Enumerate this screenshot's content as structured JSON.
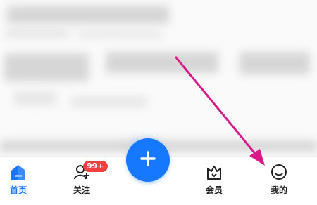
{
  "tabbar": {
    "tabs": [
      {
        "label": "首页",
        "icon": "home-icon",
        "active": true
      },
      {
        "label": "关注",
        "icon": "follow-user-icon",
        "badge": "99+"
      },
      {
        "label": "会员",
        "icon": "vip-crown-icon"
      },
      {
        "label": "我的",
        "icon": "profile-smile-icon"
      }
    ],
    "plus_icon": "plus-icon"
  },
  "colors": {
    "accent": "#1677ff",
    "badge": "#f04040",
    "annotation_arrow": "#d81b8a"
  }
}
